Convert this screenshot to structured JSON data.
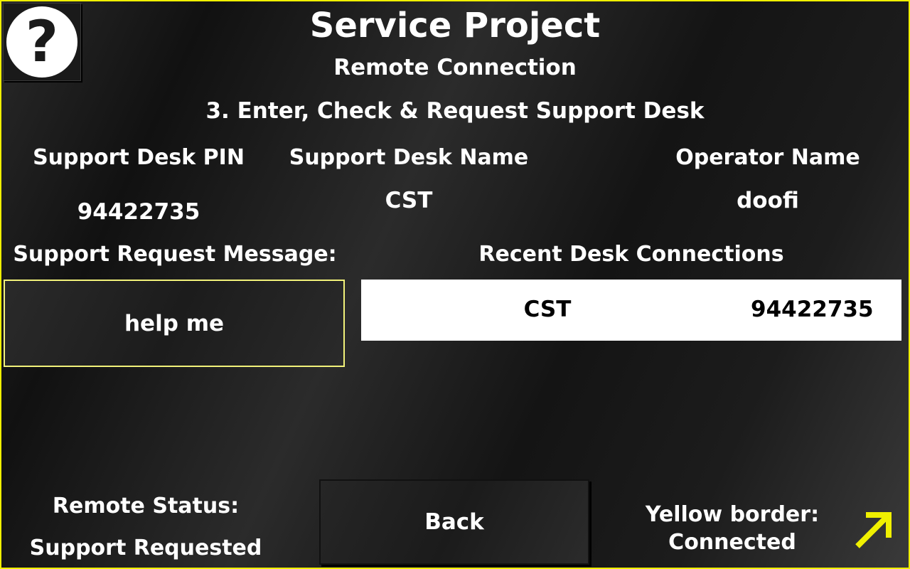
{
  "header": {
    "title": "Service Project",
    "subtitle": "Remote Connection",
    "step": "3. Enter, Check & Request Support Desk"
  },
  "help_button": {
    "glyph": "?",
    "icon": "question-mark-icon"
  },
  "fields": {
    "pin_label": "Support Desk PIN",
    "pin_value": "94422735",
    "desk_name_label": "Support Desk Name",
    "desk_name_value": "CST",
    "operator_label": "Operator Name",
    "operator_value": "doofi"
  },
  "message": {
    "label": "Support Request Message:",
    "value": "help me"
  },
  "recent": {
    "label": "Recent Desk Connections",
    "rows": [
      {
        "name": "CST",
        "pin": "94422735"
      }
    ]
  },
  "status": {
    "label": "Remote Status:",
    "value": "Support Requested"
  },
  "back_button": {
    "label": "Back"
  },
  "legend": {
    "line1": "Yellow border:",
    "line2": "Connected",
    "arrow_icon": "arrow-up-right-icon"
  },
  "colors": {
    "accent": "#f0f000",
    "box_border": "#f2f27a",
    "text": "#ffffff"
  }
}
